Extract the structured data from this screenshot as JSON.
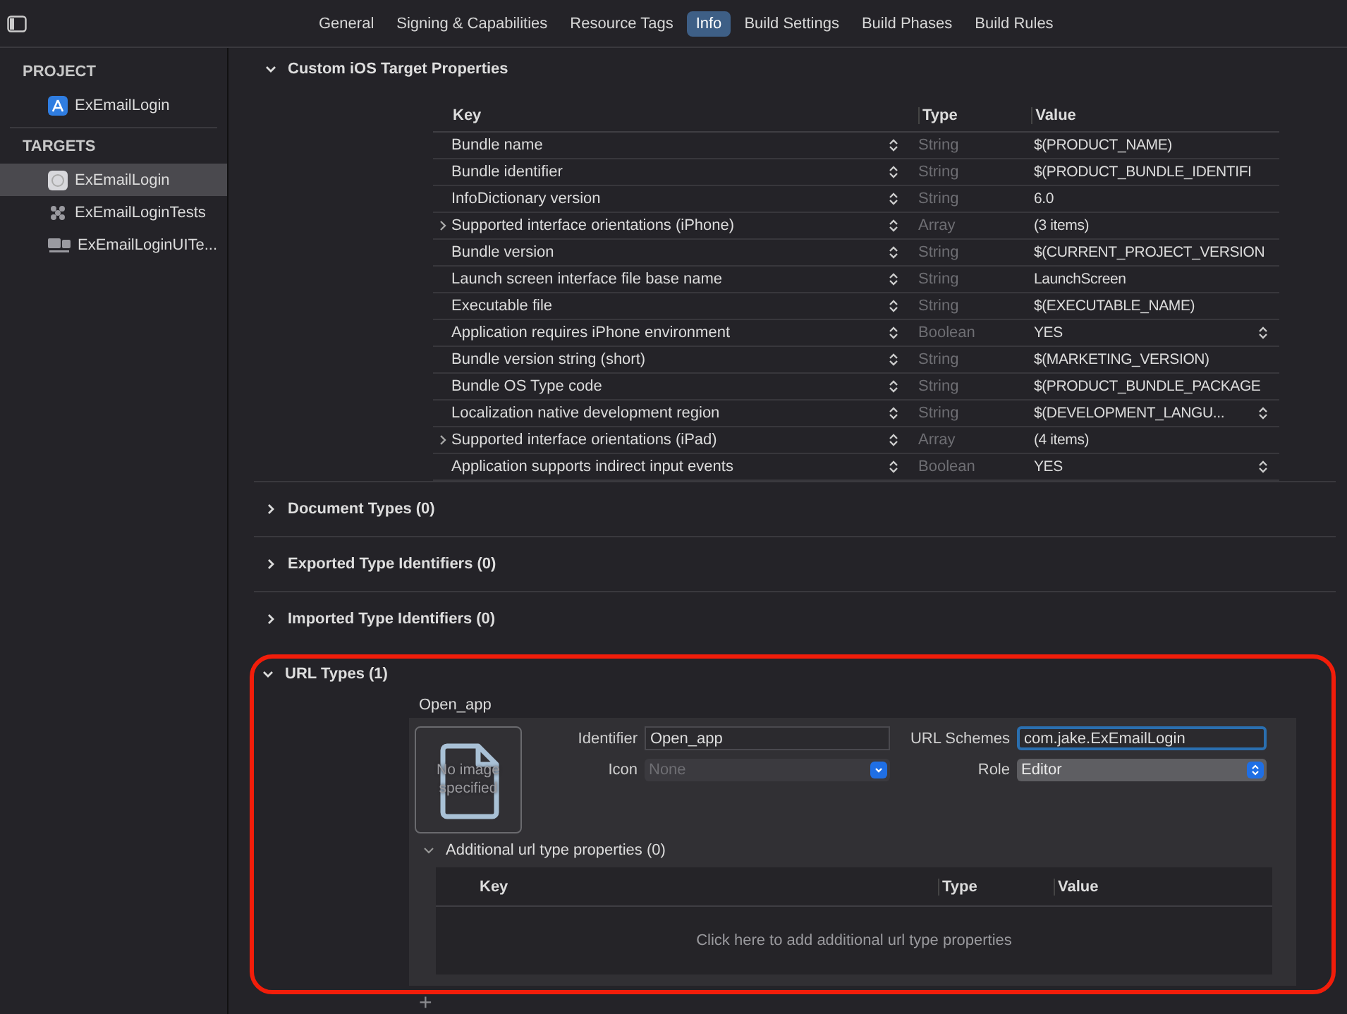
{
  "tabs": [
    {
      "label": "General",
      "selected": false
    },
    {
      "label": "Signing & Capabilities",
      "selected": false
    },
    {
      "label": "Resource Tags",
      "selected": false
    },
    {
      "label": "Info",
      "selected": true
    },
    {
      "label": "Build Settings",
      "selected": false
    },
    {
      "label": "Build Phases",
      "selected": false
    },
    {
      "label": "Build Rules",
      "selected": false
    }
  ],
  "sidebar": {
    "sections": [
      {
        "title": "PROJECT",
        "items": [
          {
            "label": "ExEmailLogin",
            "kind": "project",
            "selected": false
          }
        ]
      },
      {
        "title": "TARGETS",
        "items": [
          {
            "label": "ExEmailLogin",
            "kind": "app",
            "selected": true
          },
          {
            "label": "ExEmailLoginTests",
            "kind": "tests",
            "selected": false
          },
          {
            "label": "ExEmailLoginUITe...",
            "kind": "uitests",
            "selected": false
          }
        ]
      }
    ]
  },
  "custom_properties": {
    "title": "Custom iOS Target Properties",
    "expanded": true,
    "columns": [
      "Key",
      "Type",
      "Value"
    ],
    "rows": [
      {
        "key": "Bundle name",
        "type": "String",
        "value": "$(PRODUCT_NAME)",
        "expandable": false,
        "value_popup": false
      },
      {
        "key": "Bundle identifier",
        "type": "String",
        "value": "$(PRODUCT_BUNDLE_IDENTIFI",
        "expandable": false,
        "value_popup": false
      },
      {
        "key": "InfoDictionary version",
        "type": "String",
        "value": "6.0",
        "expandable": false,
        "value_popup": false
      },
      {
        "key": "Supported interface orientations (iPhone)",
        "type": "Array",
        "value": "(3 items)",
        "expandable": true,
        "value_popup": false
      },
      {
        "key": "Bundle version",
        "type": "String",
        "value": "$(CURRENT_PROJECT_VERSION",
        "expandable": false,
        "value_popup": false
      },
      {
        "key": "Launch screen interface file base name",
        "type": "String",
        "value": "LaunchScreen",
        "expandable": false,
        "value_popup": false
      },
      {
        "key": "Executable file",
        "type": "String",
        "value": "$(EXECUTABLE_NAME)",
        "expandable": false,
        "value_popup": false
      },
      {
        "key": "Application requires iPhone environment",
        "type": "Boolean",
        "value": "YES",
        "expandable": false,
        "value_popup": true
      },
      {
        "key": "Bundle version string (short)",
        "type": "String",
        "value": "$(MARKETING_VERSION)",
        "expandable": false,
        "value_popup": false
      },
      {
        "key": "Bundle OS Type code",
        "type": "String",
        "value": "$(PRODUCT_BUNDLE_PACKAGE",
        "expandable": false,
        "value_popup": false
      },
      {
        "key": "Localization native development region",
        "type": "String",
        "value": "$(DEVELOPMENT_LANGU...",
        "expandable": false,
        "value_popup": true
      },
      {
        "key": "Supported interface orientations (iPad)",
        "type": "Array",
        "value": "(4 items)",
        "expandable": true,
        "value_popup": false
      },
      {
        "key": "Application supports indirect input events",
        "type": "Boolean",
        "value": "YES",
        "expandable": false,
        "value_popup": true
      }
    ]
  },
  "collapsed_sections": [
    {
      "title": "Document Types (0)",
      "expanded": false
    },
    {
      "title": "Exported Type Identifiers (0)",
      "expanded": false
    },
    {
      "title": "Imported Type Identifiers (0)",
      "expanded": false
    }
  ],
  "url_types": {
    "title": "URL Types (1)",
    "expanded": true,
    "highlighted": true,
    "entry": {
      "name": "Open_app",
      "image_text": "No image specified",
      "identifier_label": "Identifier",
      "identifier": "Open_app",
      "icon_label": "Icon",
      "icon_placeholder": "None",
      "schemes_label": "URL Schemes",
      "schemes": "com.jake.ExEmailLogin",
      "role_label": "Role",
      "role": "Editor",
      "additional_title": "Additional url type properties (0)",
      "additional_expanded": true,
      "columns": [
        "Key",
        "Type",
        "Value"
      ],
      "empty_message": "Click here to add additional url type properties"
    },
    "add_button": "+"
  }
}
